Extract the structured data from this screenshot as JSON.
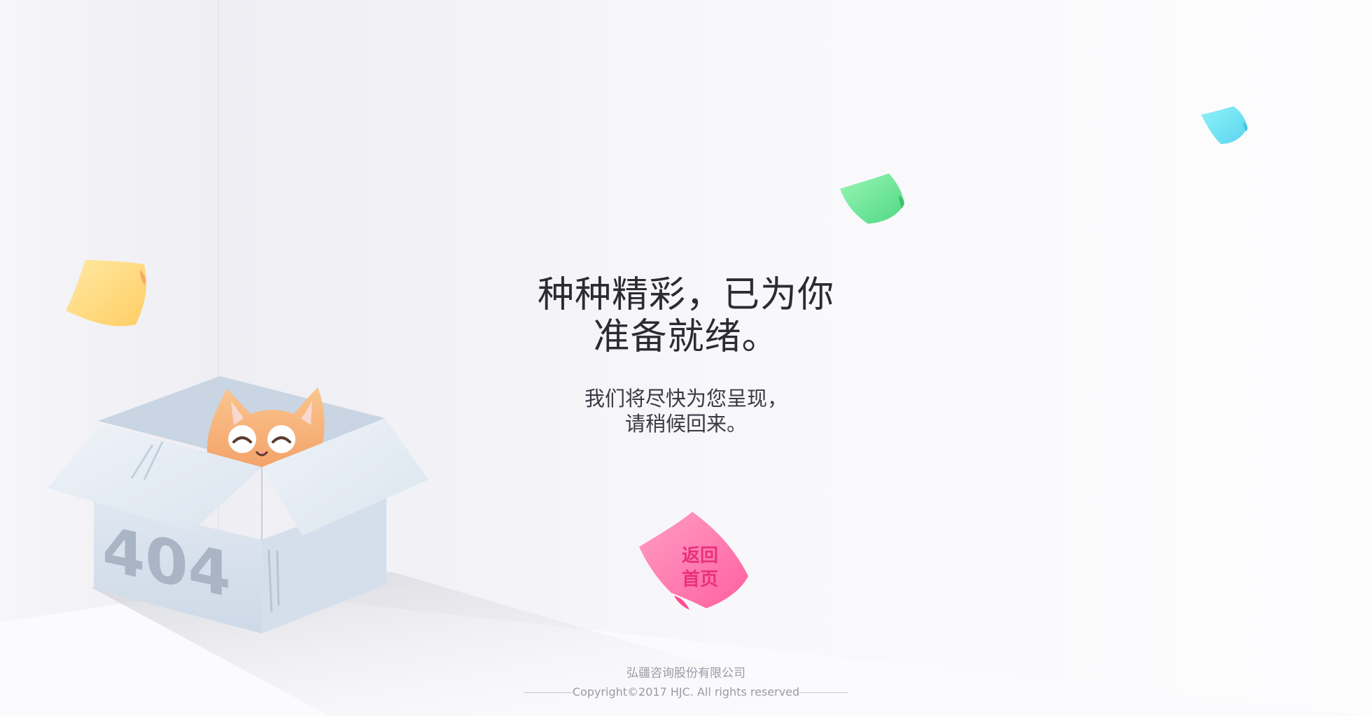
{
  "hero": {
    "title_line1": "种种精彩，已为你",
    "title_line2": "准备就绪。",
    "sub_line1": "我们将尽快为您呈现，",
    "sub_line2": "请稍候回来。"
  },
  "box": {
    "label": "404"
  },
  "home_button": {
    "line1": "返回",
    "line2": "首页"
  },
  "footer": {
    "company": "弘疆咨询股份有限公司",
    "copyright": "Copyright©2017 HJC. All rights reserved"
  },
  "icons": [
    "cat-icon",
    "open-box-icon",
    "sticky-note-icon"
  ],
  "colors": {
    "accent_pink": "#ff6fa8",
    "note_yellow": "#ffd77a",
    "note_green": "#63e08f",
    "note_cyan": "#6fe6f2",
    "cat_orange": "#f7b27a"
  }
}
